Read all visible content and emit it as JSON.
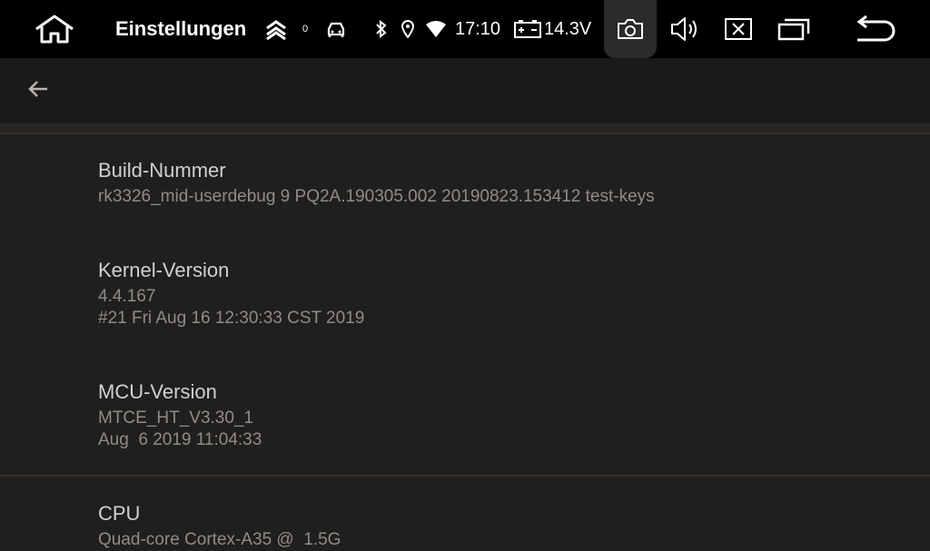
{
  "status_bar": {
    "title": "Einstellungen",
    "notification_count": "0",
    "time": "17:10",
    "voltage": "14.3V",
    "icons": [
      "home-icon",
      "chevrons-up-icon",
      "car-icon",
      "bluetooth-icon",
      "location-icon",
      "wifi-icon",
      "battery-icon",
      "camera-icon",
      "volume-icon",
      "close-app-icon",
      "recent-apps-icon",
      "back-arrow-icon"
    ]
  },
  "app_bar": {
    "back_icon": "arrow-left-icon"
  },
  "entries": [
    {
      "title": "Build-Nummer",
      "lines": [
        "rk3326_mid-userdebug 9 PQ2A.190305.002 20190823.153412 test-keys"
      ]
    },
    {
      "title": "Kernel-Version",
      "lines": [
        "4.4.167",
        "#21 Fri Aug 16 12:30:33 CST 2019"
      ]
    },
    {
      "title": "MCU-Version",
      "lines": [
        "MTCE_HT_V3.30_1",
        "Aug  6 2019 11:04:33"
      ]
    },
    {
      "title": "CPU",
      "lines": [
        "Quad-core Cortex-A35 @  1.5G"
      ]
    }
  ],
  "colors": {
    "background": "#211f1d",
    "status_bar": "#000000",
    "title_text": "#d2d0ce",
    "value_text": "#8f8c89"
  }
}
